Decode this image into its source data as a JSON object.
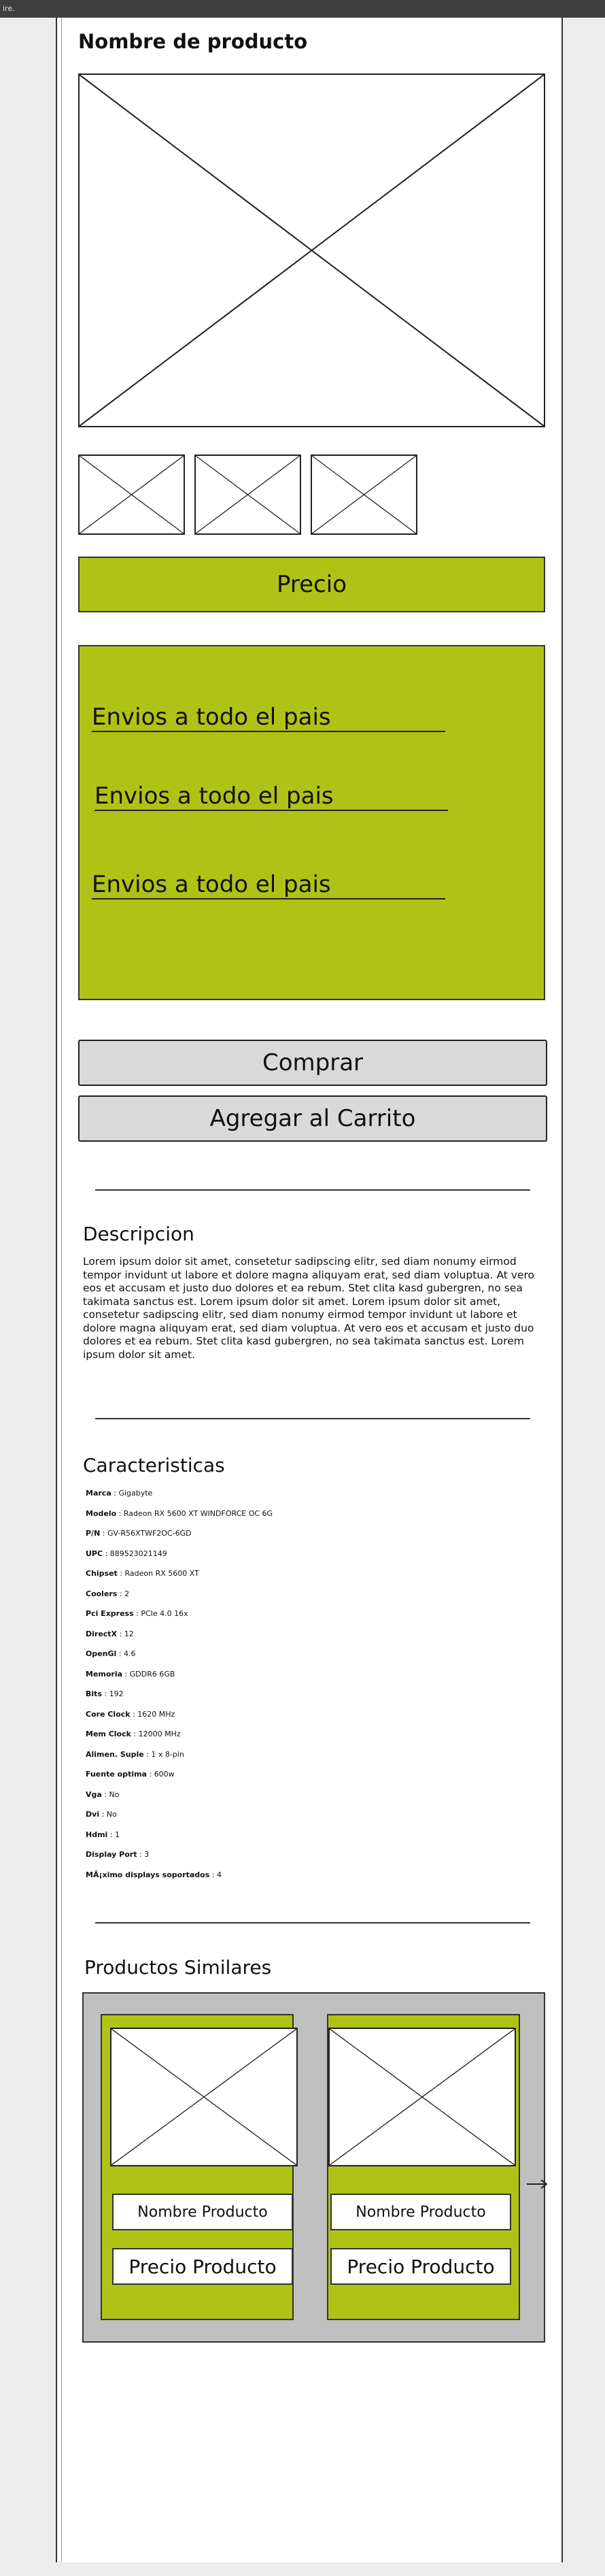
{
  "window": {
    "title": "ire."
  },
  "product": {
    "title": "Nombre de producto",
    "price_label": "Precio"
  },
  "shipping": {
    "lines": [
      "Envios a todo el pais",
      "Envios a todo el pais",
      "Envios a todo el pais"
    ]
  },
  "buttons": {
    "buy": "Comprar",
    "add_to_cart": "Agregar al Carrito"
  },
  "description": {
    "heading": "Descripcion",
    "body": "Lorem ipsum dolor sit amet, consetetur sadipscing elitr, sed diam nonumy eirmod tempor invidunt ut labore et dolore magna aliquyam erat, sed diam voluptua. At vero eos et accusam et justo duo dolores et ea rebum. Stet clita kasd gubergren, no sea takimata sanctus est. Lorem ipsum dolor sit amet. Lorem ipsum dolor sit amet, consetetur sadipscing elitr, sed diam nonumy eirmod tempor invidunt ut labore et dolore magna aliquyam erat, sed diam voluptua. At vero eos et accusam et justo duo dolores et ea rebum. Stet clita kasd gubergren, no sea takimata sanctus est. Lorem ipsum dolor sit amet."
  },
  "features": {
    "heading": "Caracteristicas",
    "items": [
      {
        "key": "Marca",
        "value": "Gigabyte"
      },
      {
        "key": "Modelo",
        "value": "Radeon RX 5600 XT WINDFORCE OC 6G"
      },
      {
        "key": "P/N",
        "value": "GV-R56XTWF2OC-6GD"
      },
      {
        "key": "UPC",
        "value": "889523021149"
      },
      {
        "key": "Chipset",
        "value": "Radeon RX 5600 XT"
      },
      {
        "key": "Coolers",
        "value": "2"
      },
      {
        "key": "Pci Express",
        "value": "PCIe 4.0 16x"
      },
      {
        "key": "DirectX",
        "value": "12"
      },
      {
        "key": "OpenGl",
        "value": "4.6"
      },
      {
        "key": "Memoria",
        "value": "GDDR6 6GB"
      },
      {
        "key": "Bits",
        "value": "192"
      },
      {
        "key": "Core Clock",
        "value": "1620 MHz"
      },
      {
        "key": "Mem Clock",
        "value": "12000 MHz"
      },
      {
        "key": "Alimen. Suple",
        "value": "1 x 8-pin"
      },
      {
        "key": "Fuente optima",
        "value": "600w"
      },
      {
        "key": "Vga",
        "value": "No"
      },
      {
        "key": "Dvi",
        "value": "No"
      },
      {
        "key": "Hdmi",
        "value": "1"
      },
      {
        "key": "Display Port",
        "value": "3"
      },
      {
        "key": "MÃ¡ximo displays soportados",
        "value": "4"
      }
    ]
  },
  "similar": {
    "heading": "Productos Similares",
    "cards": [
      {
        "name": "Nombre Producto",
        "price": "Precio Producto"
      },
      {
        "name": "Nombre Producto",
        "price": "Precio Producto"
      }
    ]
  },
  "colors": {
    "accent_green": "#aec316",
    "button_grey": "#d9d9d9",
    "carousel_grey": "#c0c0c0"
  }
}
